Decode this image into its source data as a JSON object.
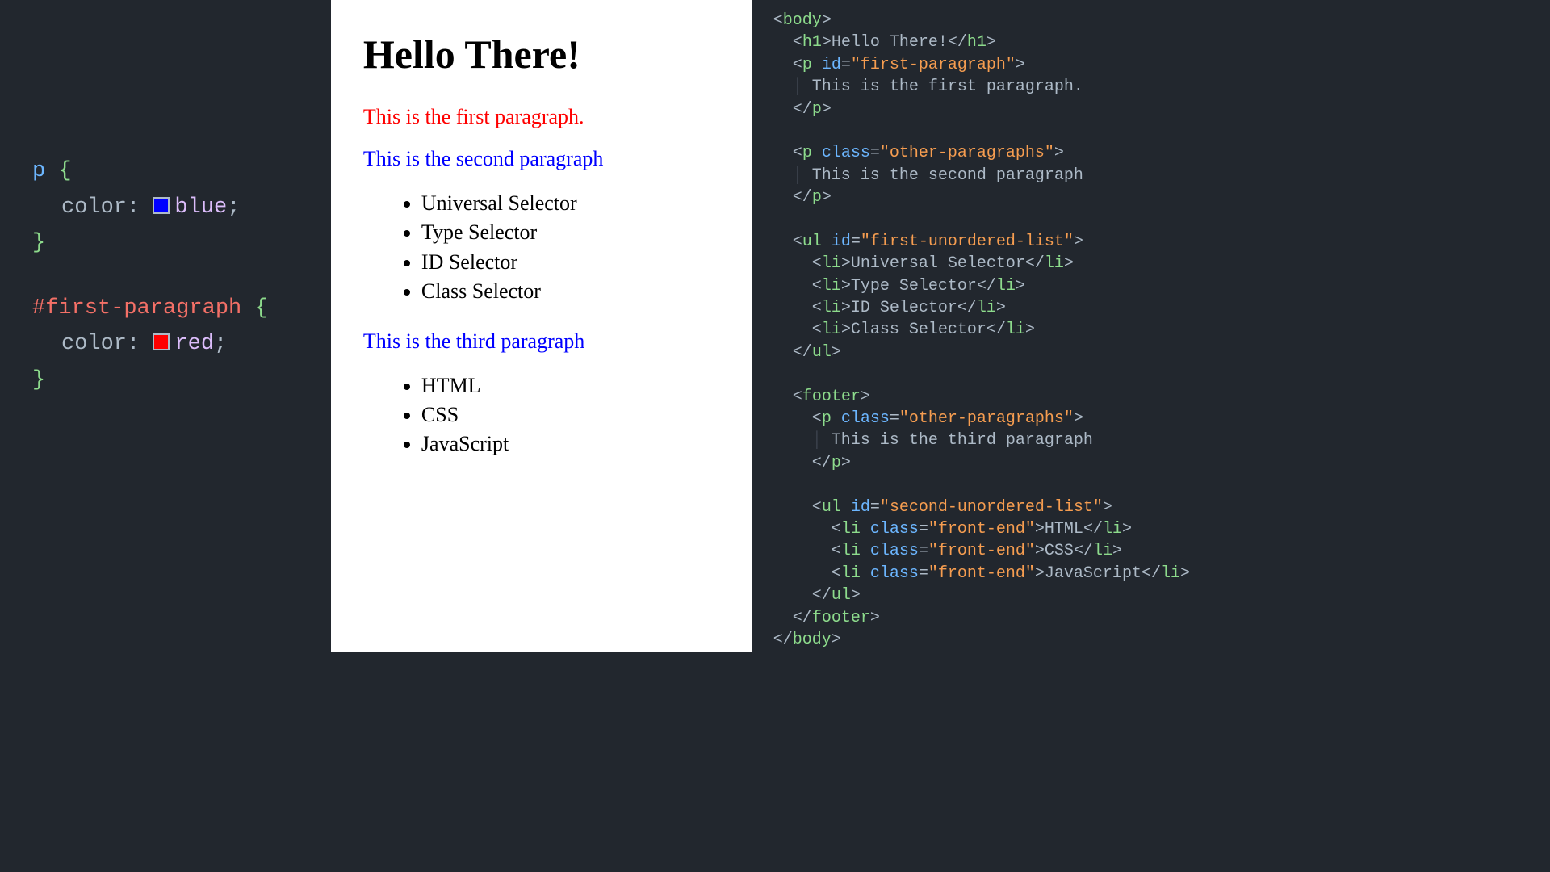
{
  "css_panel": {
    "rule1": {
      "selector": "p",
      "prop": "color",
      "value": "blue",
      "swatch": "#0000ff"
    },
    "rule2": {
      "selector": "#first-paragraph",
      "prop": "color",
      "value": "red",
      "swatch": "#ff0000"
    }
  },
  "preview": {
    "heading": "Hello There!",
    "p1": "This is the first paragraph.",
    "p2": "This is the second paragraph",
    "list1": [
      "Universal Selector",
      "Type Selector",
      "ID Selector",
      "Class Selector"
    ],
    "p3": "This is the third paragraph",
    "list2": [
      "HTML",
      "CSS",
      "JavaScript"
    ]
  },
  "html_panel": {
    "t_body": "body",
    "t_h1": "h1",
    "t_p": "p",
    "t_ul": "ul",
    "t_li": "li",
    "t_footer": "footer",
    "a_id": "id",
    "a_class": "class",
    "v_first_para": "\"first-paragraph\"",
    "v_other_para": "\"other-paragraphs\"",
    "v_first_ul": "\"first-unordered-list\"",
    "v_second_ul": "\"second-unordered-list\"",
    "v_front_end": "\"front-end\"",
    "txt_h1": "Hello There!",
    "txt_p1": "This is the first paragraph.",
    "txt_p2": "This is the second paragraph",
    "txt_li1": "Universal Selector",
    "txt_li2": "Type Selector",
    "txt_li3": "ID Selector",
    "txt_li4": "Class Selector",
    "txt_p3": "This is the third paragraph",
    "txt_li5": "HTML",
    "txt_li6": "CSS",
    "txt_li7": "JavaScript"
  }
}
